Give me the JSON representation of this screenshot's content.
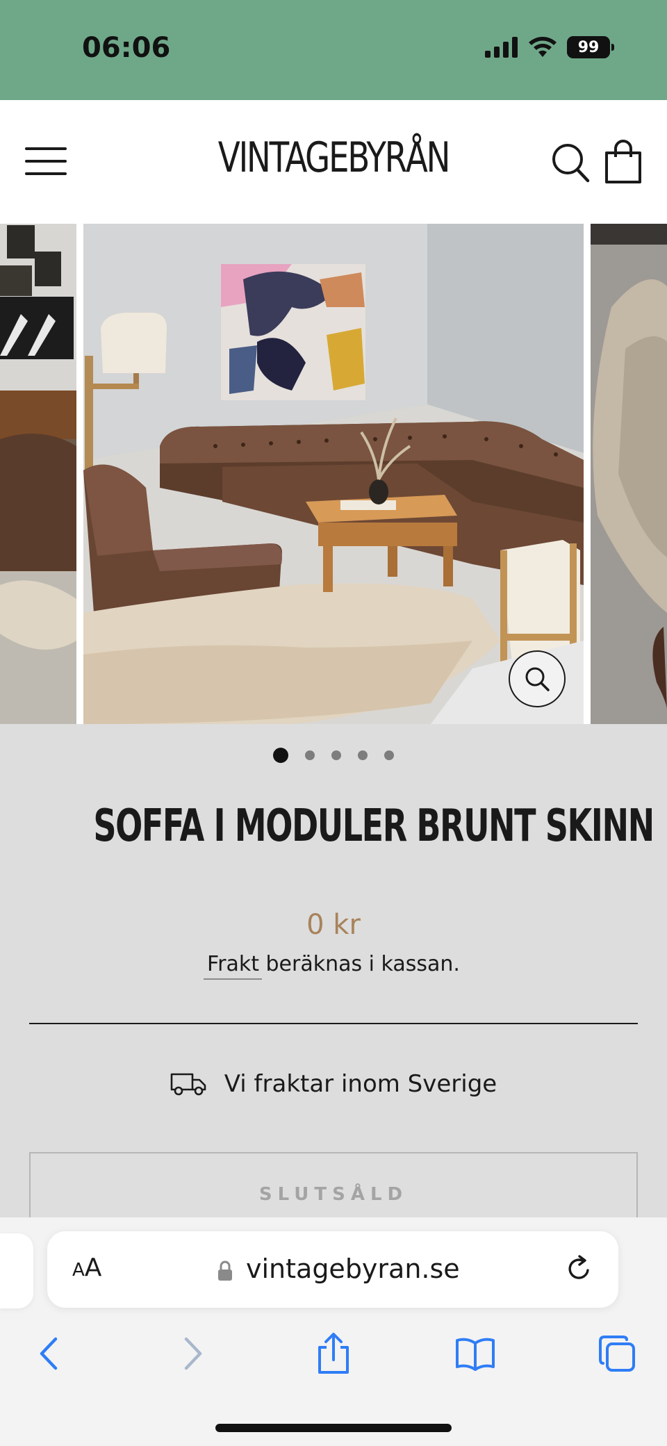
{
  "status_bar": {
    "time": "06:06",
    "battery": "99"
  },
  "header": {
    "logo": "VINTAGEBYRÅN"
  },
  "gallery": {
    "image_count": 5,
    "active_index": 1
  },
  "product": {
    "title": "SOFFA I MODULER BRUNT SKINN",
    "price": "0 kr",
    "shipping_note_link": "Frakt",
    "shipping_note_rest": " beräknas i kassan.",
    "shipping_info": "Vi fraktar inom Sverige",
    "button_label": "SLUTSÅLD"
  },
  "browser": {
    "text_size_small": "A",
    "text_size_big": "A",
    "url": "vintagebyran.se"
  },
  "colors": {
    "status_bar": "#6fa889",
    "price": "#a8835a",
    "browser_accent": "#2f7df6"
  }
}
